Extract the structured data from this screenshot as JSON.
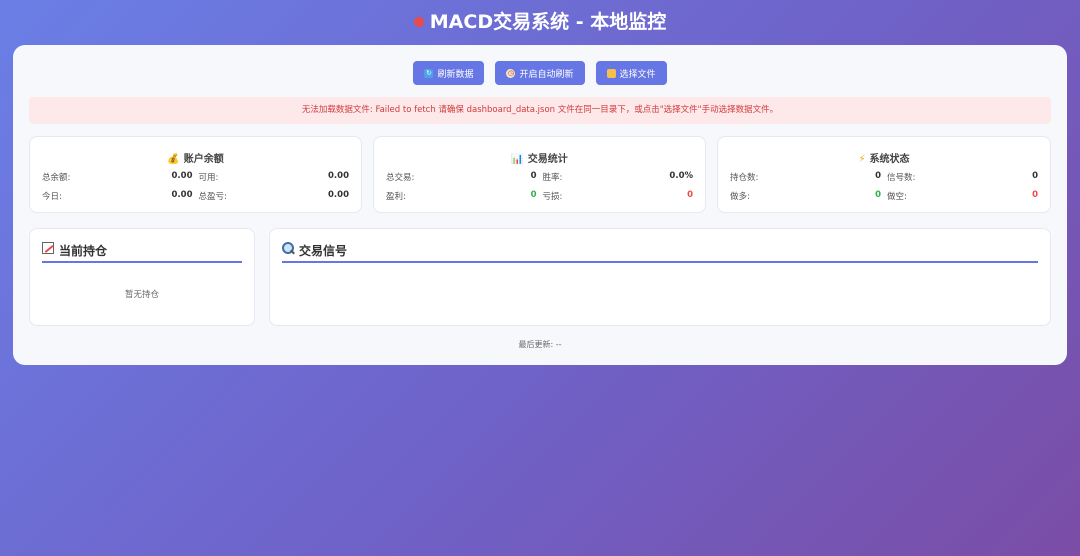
{
  "header": {
    "title": "MACD交易系统 - 本地监控"
  },
  "toolbar": {
    "refresh_label": "刷新数据",
    "auto_refresh_label": "开启自动刷新",
    "choose_file_label": "选择文件"
  },
  "error": {
    "message": "无法加载数据文件: Failed to fetch 请确保 dashboard_data.json 文件在同一目录下，或点击\"选择文件\"手动选择数据文件。"
  },
  "account": {
    "title": "账户余额",
    "total_balance_label": "总余额:",
    "total_balance": "0.00",
    "available_label": "可用:",
    "available": "0.00",
    "today_label": "今日:",
    "today": "0.00",
    "total_pnl_label": "总盈亏:",
    "total_pnl": "0.00"
  },
  "trading": {
    "title": "交易统计",
    "total_trades_label": "总交易:",
    "total_trades": "0",
    "win_rate_label": "胜率:",
    "win_rate": "0.0%",
    "profit_label": "盈利:",
    "profit": "0",
    "loss_label": "亏损:",
    "loss": "0"
  },
  "system": {
    "title": "系统状态",
    "positions_label": "持仓数:",
    "positions": "0",
    "signals_label": "信号数:",
    "signals": "0",
    "long_label": "做多:",
    "long": "0",
    "short_label": "做空:",
    "short": "0"
  },
  "positions_section": {
    "title": "当前持仓",
    "empty_text": "暂无持仓"
  },
  "signals_section": {
    "title": "交易信号"
  },
  "footer": {
    "last_update": "最后更新: --"
  },
  "colors": {
    "accent": "#6676e4",
    "positive": "#2fb14d",
    "negative": "#e94b4b",
    "error_bg": "#fde9ea"
  }
}
